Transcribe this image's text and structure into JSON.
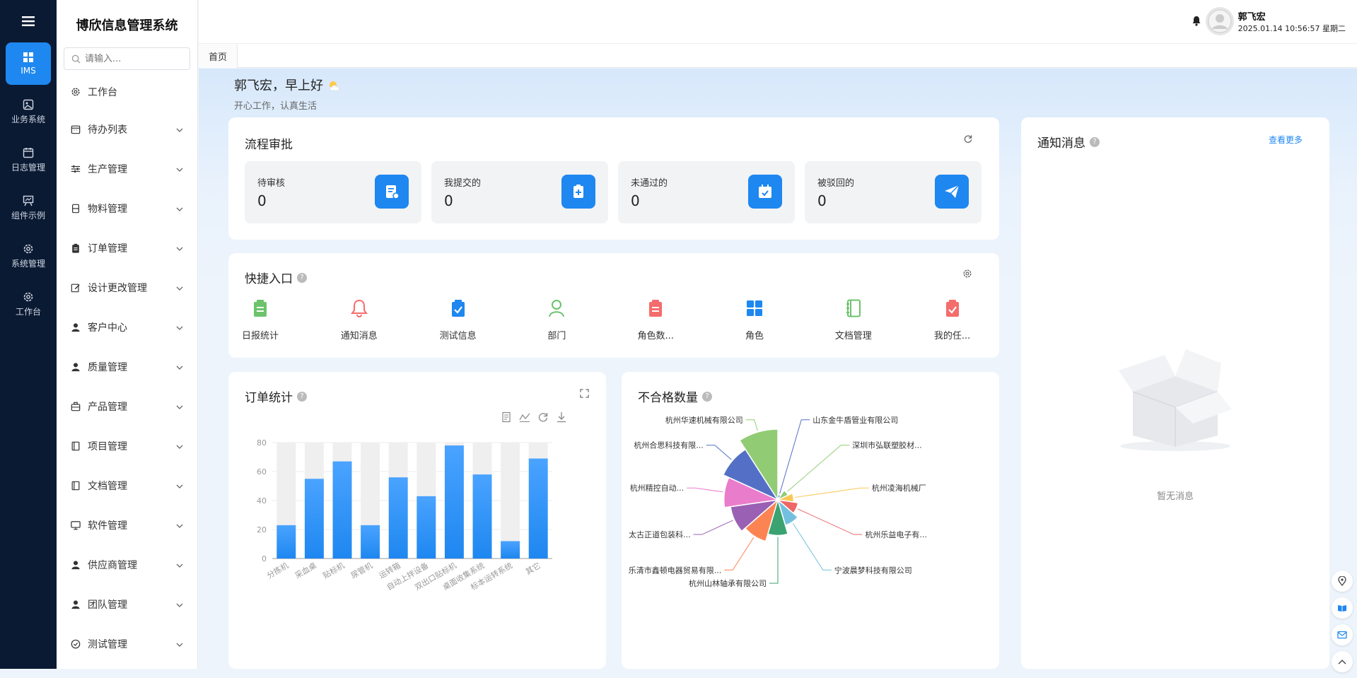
{
  "rail": {
    "items": [
      {
        "label": "IMS",
        "icon": "grid-icon"
      },
      {
        "label": "业务系统",
        "icon": "image-icon"
      },
      {
        "label": "日志管理",
        "icon": "calendar-icon"
      },
      {
        "label": "组件示例",
        "icon": "board-icon"
      },
      {
        "label": "系统管理",
        "icon": "gear-icon"
      },
      {
        "label": "工作台",
        "icon": "gear-icon"
      }
    ]
  },
  "sidebar": {
    "brand": "博欣信息管理系统",
    "search_placeholder": "请输入...",
    "items": [
      {
        "label": "工作台",
        "icon": "gear-icon",
        "expandable": false
      },
      {
        "label": "待办列表",
        "icon": "calendar-icon",
        "expandable": true
      },
      {
        "label": "生产管理",
        "icon": "sliders-icon",
        "expandable": true
      },
      {
        "label": "物料管理",
        "icon": "box-icon",
        "expandable": true
      },
      {
        "label": "订单管理",
        "icon": "clipboard-icon",
        "expandable": true
      },
      {
        "label": "设计更改管理",
        "icon": "edit-icon",
        "expandable": true
      },
      {
        "label": "客户中心",
        "icon": "user-icon",
        "expandable": true
      },
      {
        "label": "质量管理",
        "icon": "user-icon",
        "expandable": true
      },
      {
        "label": "产品管理",
        "icon": "briefcase-icon",
        "expandable": true
      },
      {
        "label": "项目管理",
        "icon": "book-icon",
        "expandable": true
      },
      {
        "label": "文档管理",
        "icon": "book-icon",
        "expandable": true
      },
      {
        "label": "软件管理",
        "icon": "monitor-icon",
        "expandable": true
      },
      {
        "label": "供应商管理",
        "icon": "user-icon",
        "expandable": true
      },
      {
        "label": "团队管理",
        "icon": "user-icon",
        "expandable": true
      },
      {
        "label": "测试管理",
        "icon": "check-circle-icon",
        "expandable": true
      }
    ]
  },
  "header": {
    "username": "郭飞宏",
    "datetime": "2025.01.14 10:56:57 星期二"
  },
  "tabs": [
    {
      "label": "首页"
    }
  ],
  "greeting": {
    "title": "郭飞宏，早上好",
    "subtitle": "开心工作，认真生活"
  },
  "approval": {
    "title": "流程审批",
    "stats": [
      {
        "label": "待审核",
        "value": "0"
      },
      {
        "label": "我提交的",
        "value": "0"
      },
      {
        "label": "未通过的",
        "value": "0"
      },
      {
        "label": "被驳回的",
        "value": "0"
      }
    ]
  },
  "quick": {
    "title": "快捷入口",
    "items": [
      {
        "label": "日报统计",
        "icon": "clipboard-icon",
        "color": "#6cc36c"
      },
      {
        "label": "通知消息",
        "icon": "bell-icon",
        "color": "#f56c6c"
      },
      {
        "label": "测试信息",
        "icon": "check-clipboard-icon",
        "color": "#1e87f0"
      },
      {
        "label": "部门",
        "icon": "user-icon",
        "color": "#6cc36c"
      },
      {
        "label": "角色数...",
        "icon": "clipboard-icon",
        "color": "#f56c6c"
      },
      {
        "label": "角色",
        "icon": "grid-icon",
        "color": "#1e87f0"
      },
      {
        "label": "文档管理",
        "icon": "notebook-icon",
        "color": "#6cc36c"
      },
      {
        "label": "我的任...",
        "icon": "check-clipboard-icon",
        "color": "#f56c6c"
      }
    ]
  },
  "orders": {
    "title": "订单统计",
    "chart_data": {
      "type": "bar",
      "categories": [
        "分拣机",
        "采血桌",
        "贴标机",
        "尿管机",
        "运转箱",
        "自动上拌设备",
        "双出口贴标机",
        "桌面收集系统",
        "标本运转系统",
        "其它"
      ],
      "values": [
        23,
        55,
        67,
        23,
        56,
        43,
        78,
        58,
        12,
        69
      ],
      "background_max": 80,
      "ylim": [
        0,
        80
      ],
      "yticks": [
        0,
        20,
        40,
        60,
        80
      ],
      "color": "#1e87f0"
    }
  },
  "defects": {
    "title": "不合格数量",
    "chart_data": {
      "type": "pie",
      "rose": true,
      "labels": [
        "山东金牛盾管业有限公司",
        "深圳市弘联塑胶材...",
        "杭州凌海机械厂",
        "杭州乐益电子有...",
        "宁波晨梦科技有限公司",
        "杭州山林轴承有限公司",
        "乐清市鑫顿电器贸易有限...",
        "太古正道包装科...",
        "杭州精控自动...",
        "杭州合思科技有限...",
        "杭州华速机械有限公司"
      ],
      "values": [
        2,
        6,
        9,
        12,
        16,
        22,
        27,
        30,
        34,
        38,
        45
      ],
      "colors": [
        "#5470c6",
        "#91cc75",
        "#fac858",
        "#ee6666",
        "#73c0de",
        "#3ba272",
        "#fc8452",
        "#9a60b4",
        "#ea7ccc",
        "#5470c6",
        "#91cc75"
      ]
    }
  },
  "notice": {
    "title": "通知消息",
    "more": "查看更多",
    "empty": "暂无消息"
  }
}
